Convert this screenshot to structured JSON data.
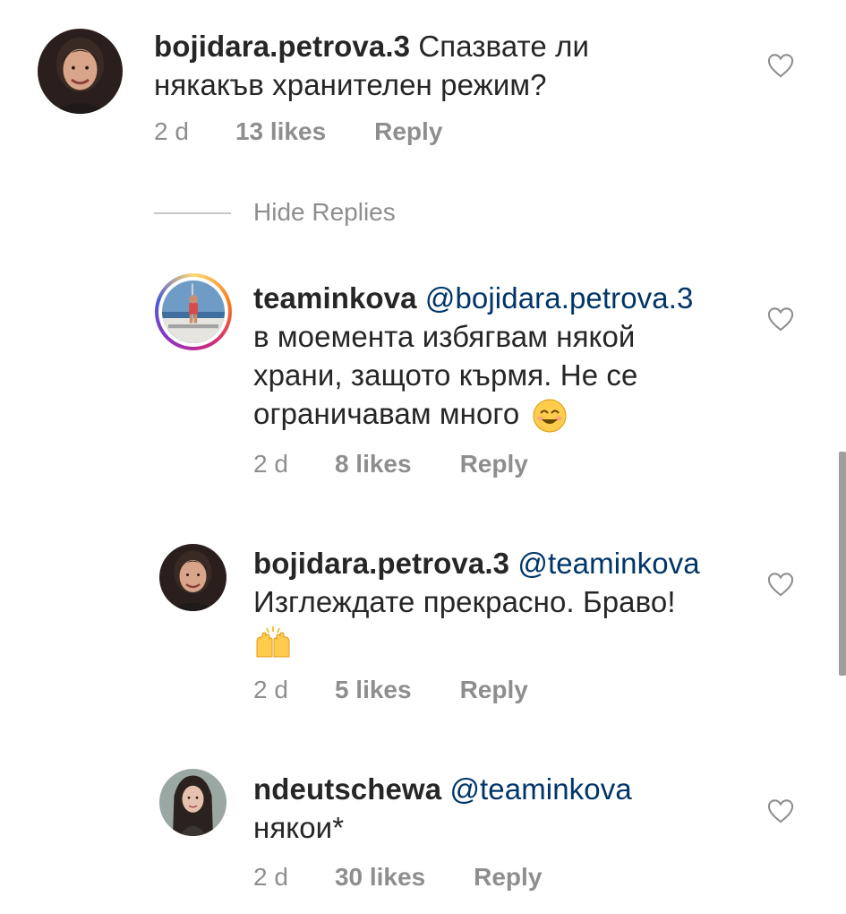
{
  "comments": [
    {
      "username": "bojidara.petrova.3",
      "mention": "",
      "text_line1": "Спазвате ли",
      "text_line2": "някакъв хранителен режим?",
      "time": "2 d",
      "likes": "13 likes",
      "reply": "Reply"
    },
    {
      "username": "teaminkova",
      "mention": "@bojidara.petrova.3",
      "text_line1": "в моемента избягвам някой",
      "text_line2": "храни, защото кърмя. Не се",
      "text_line3": "ограничавам много",
      "emoji": "smiling-face-emoji",
      "time": "2 d",
      "likes": "8 likes",
      "reply": "Reply"
    },
    {
      "username": "bojidara.petrova.3",
      "mention": "@teaminkova",
      "text_line1": "Изглеждате прекрасно. Браво!",
      "emoji": "raising-hands-emoji",
      "time": "2 d",
      "likes": "5 likes",
      "reply": "Reply"
    },
    {
      "username": "ndeutschewa",
      "mention": "@teaminkova",
      "text_line1": "някои*",
      "time": "2 d",
      "likes": "30 likes",
      "reply": "Reply"
    }
  ],
  "hide_replies": "Hide Replies",
  "colors": {
    "username": "#262626",
    "mention": "#003569",
    "meta": "#8e8e8e",
    "divider": "#c7c7c7"
  }
}
